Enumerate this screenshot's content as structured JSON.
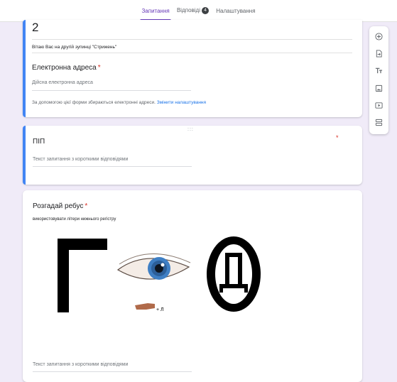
{
  "tabs": [
    {
      "label": "Запитання",
      "active": true
    },
    {
      "label": "Відповіді",
      "badge": "4"
    },
    {
      "label": "Налаштування"
    }
  ],
  "section_card": {
    "number": "2",
    "description": "Вітаю Вас на другій зупинці \"Стрижень\"",
    "email_title": "Електронна адреса",
    "required_mark": "*",
    "email_placeholder": "Дійсна електронна адреса",
    "email_notice": "За допомогою цієї форми збираються електронні адреси.",
    "email_link": "Змінити налаштування"
  },
  "question_pib": {
    "drag_handle": ":::",
    "title": "ПІП",
    "required_mark": "*",
    "answer_placeholder": "Текст запитання з короткими відповідями"
  },
  "question_rebus": {
    "title": "Розгадай ребус",
    "required_mark": "*",
    "hint": "використовувати літери нижнього регістру",
    "image_letter_left": "Г",
    "image_letter_inner": "Д",
    "image_small_text": "+ Л",
    "answer_placeholder": "Текст запитання з короткими відповідями"
  },
  "side_toolbar": {
    "icons": [
      "add-question-icon",
      "import-questions-icon",
      "add-title-icon",
      "add-image-icon",
      "add-video-icon",
      "add-section-icon"
    ]
  },
  "colors": {
    "accent": "#673ab7",
    "left_border": "#4285f4",
    "required": "#d93025",
    "link": "#1a73e8",
    "background": "#f0ebf8"
  }
}
